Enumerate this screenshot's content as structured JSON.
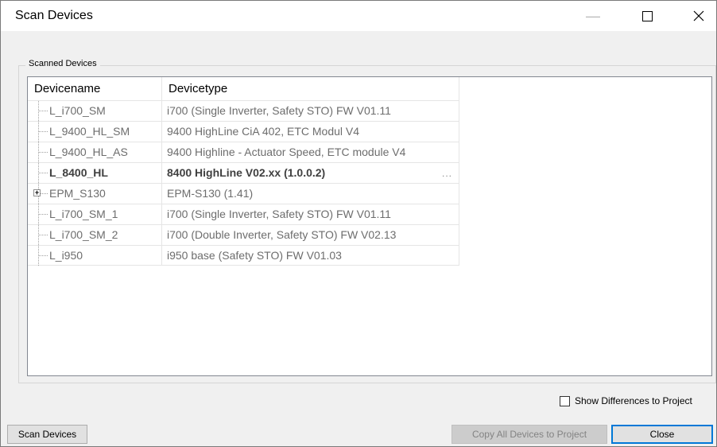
{
  "window": {
    "title": "Scan Devices",
    "minimize_icon": "minimize-icon",
    "maximize_icon": "maximize-icon",
    "close_icon": "close-icon"
  },
  "group": {
    "legend": "Scanned Devices"
  },
  "table": {
    "columns": [
      "Devicename",
      "Devicetype"
    ],
    "rows": [
      {
        "name": "L_i700_SM",
        "type": "i700 (Single Inverter, Safety STO) FW V01.11"
      },
      {
        "name": "L_9400_HL_SM",
        "type": "9400 HighLine CiA 402, ETC Modul V4"
      },
      {
        "name": "L_9400_HL_AS",
        "type": "9400 Highline - Actuator Speed, ETC module V4"
      },
      {
        "name": "L_8400_HL",
        "type": "8400 HighLine V02.xx (1.0.0.2)",
        "ellipsis": "..."
      },
      {
        "name": "EPM_S130",
        "type": "EPM-S130 (1.41)",
        "expander": "+"
      },
      {
        "name": "L_i700_SM_1",
        "type": "i700 (Single Inverter, Safety STO) FW V01.11"
      },
      {
        "name": "L_i700_SM_2",
        "type": "i700 (Double Inverter, Safety STO) FW V02.13"
      },
      {
        "name": "L_i950",
        "type": "i950 base (Safety STO) FW V01.03"
      }
    ]
  },
  "options": {
    "show_differences_label": "Show Differences to Project",
    "show_differences_checked": false
  },
  "buttons": {
    "scan_label": "Scan Devices",
    "copy_label": "Copy All Devices to Project",
    "copy_enabled": false,
    "close_label": "Close"
  },
  "colors": {
    "accent": "#0078d7",
    "background": "#f0f0f0"
  }
}
